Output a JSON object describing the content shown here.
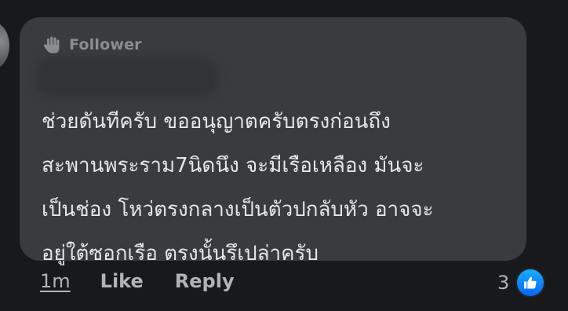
{
  "comment": {
    "badge_label": "Follower",
    "badge_icon": "waving-hand-icon",
    "author_name": "",
    "text_lines": [
      "ช่วยดันทีครับ ขออนุญาตครับตรงก่อนถึง",
      "สะพานพระราม7นิดนึง จะมีเรือเหลือง มันจะ",
      "เป็นช่อง โหว่ตรงกลางเป็นตัวปกลับหัว อาจจะ",
      "อยู่ใต้ซอกเรือ ตรงนั้นรึเปล่าครับ"
    ]
  },
  "actions": {
    "time": "1m",
    "like_label": "Like",
    "reply_label": "Reply"
  },
  "reactions": {
    "count": "3",
    "icon": "thumbs-up-icon",
    "color": "#0866ff"
  },
  "colors": {
    "background": "#18191a",
    "bubble": "#3a3b3c",
    "text": "#e4e6eb",
    "muted": "#b0b3b8"
  }
}
